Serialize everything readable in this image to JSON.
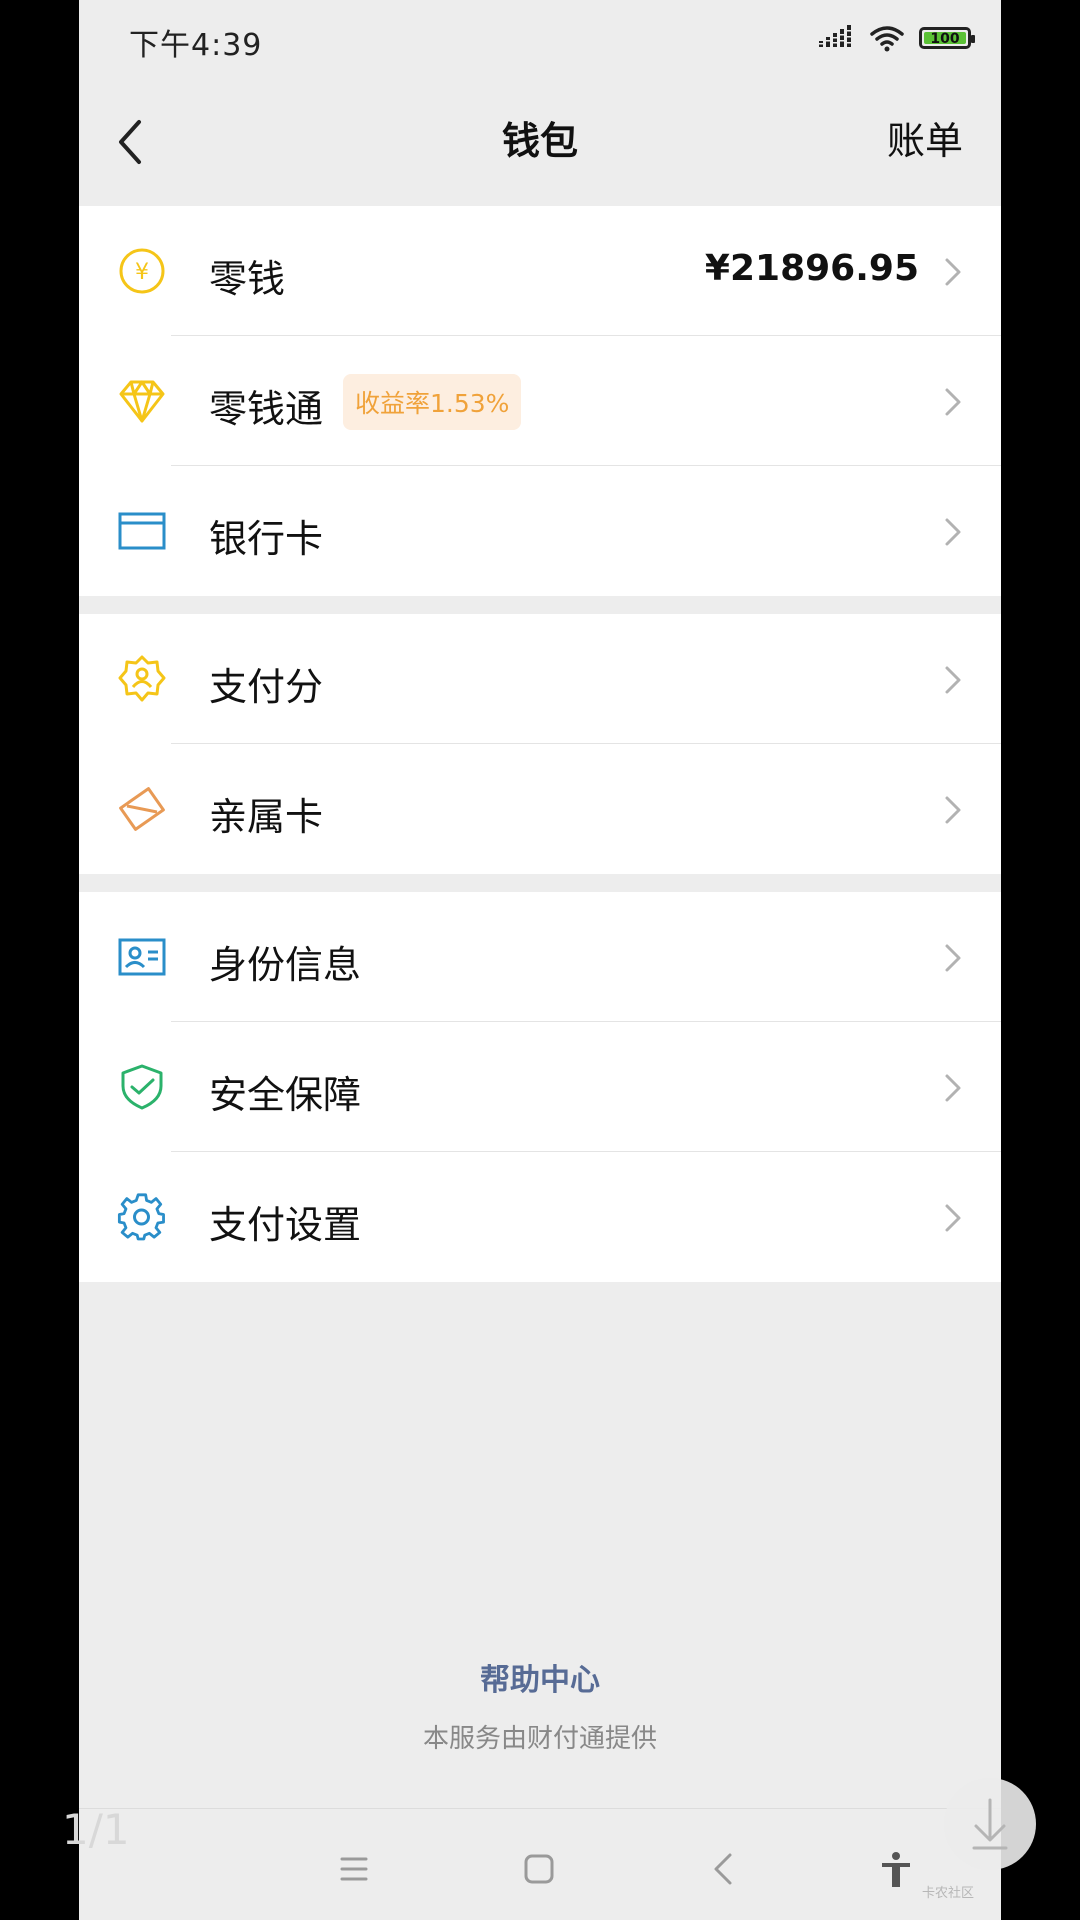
{
  "status_bar": {
    "time": "下午4:39",
    "battery": "100"
  },
  "nav": {
    "title": "钱包",
    "right_action": "账单"
  },
  "groups": [
    {
      "items": [
        {
          "label": "零钱",
          "value": "¥21896.95",
          "icon": "yuan-coin-icon",
          "icon_color": "#f5c518"
        },
        {
          "label": "零钱通",
          "badge": "收益率1.53%",
          "icon": "diamond-icon",
          "icon_color": "#f5c518"
        },
        {
          "label": "银行卡",
          "icon": "bank-card-icon",
          "icon_color": "#2a8ec9"
        }
      ]
    },
    {
      "items": [
        {
          "label": "支付分",
          "icon": "badge-icon",
          "icon_color": "#f5c518"
        },
        {
          "label": "亲属卡",
          "icon": "family-card-icon",
          "icon_color": "#e89a55"
        }
      ]
    },
    {
      "items": [
        {
          "label": "身份信息",
          "icon": "id-card-icon",
          "icon_color": "#2a8ec9"
        },
        {
          "label": "安全保障",
          "icon": "shield-icon",
          "icon_color": "#2bb26b"
        },
        {
          "label": "支付设置",
          "icon": "gear-icon",
          "icon_color": "#2a8ec9"
        }
      ]
    }
  ],
  "footer": {
    "help_center": "帮助中心",
    "provider_note": "本服务由财付通提供"
  },
  "viewer": {
    "page_indicator": "1/1",
    "watermark": "卡农社区"
  },
  "colors": {
    "link": "#576b95",
    "badge_bg": "#fdeee0",
    "badge_text": "#f0a23a",
    "background": "#ededed"
  }
}
